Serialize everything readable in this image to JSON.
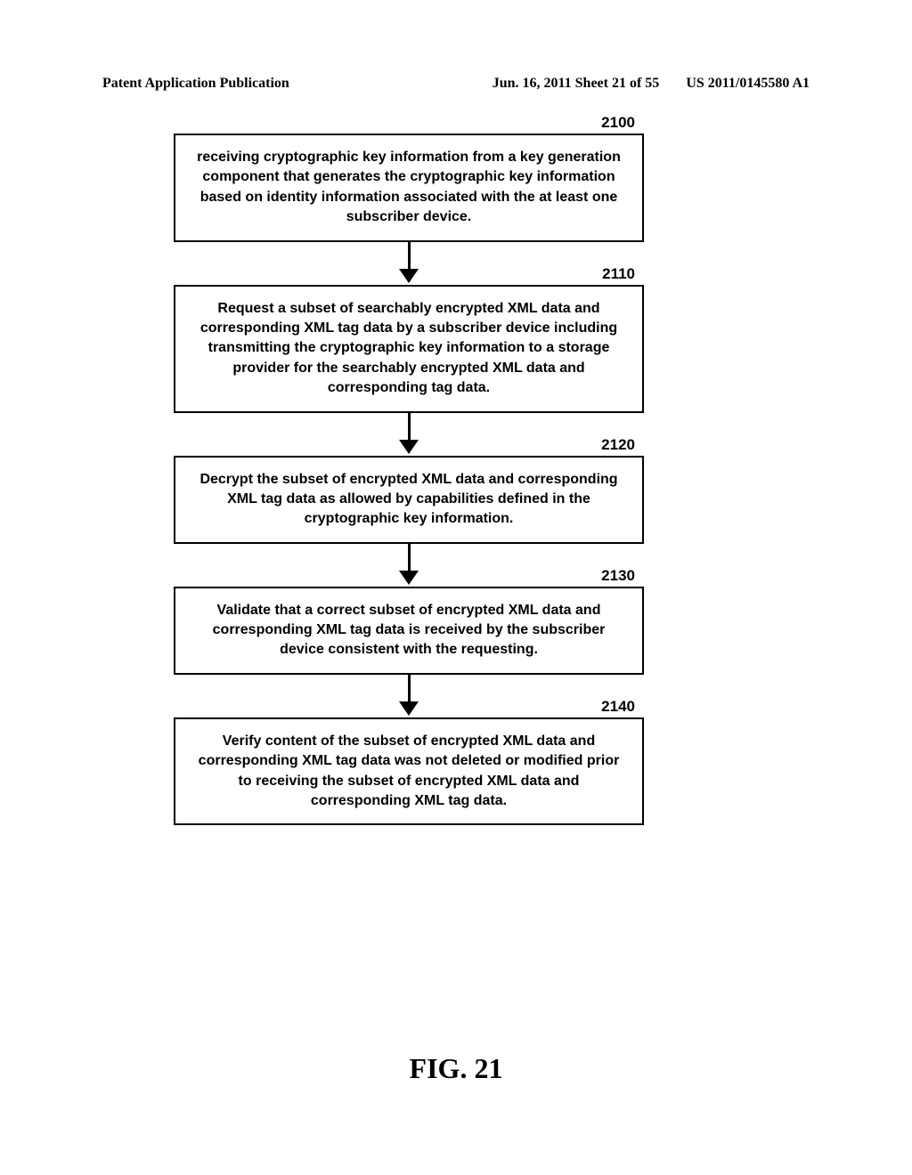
{
  "header": {
    "left": "Patent Application Publication",
    "center": "Jun. 16, 2011  Sheet 21 of 55",
    "right": "US 2011/0145580 A1"
  },
  "steps": [
    {
      "label": "2100",
      "text": "receiving cryptographic key information from a key generation component that generates the cryptographic key information based on identity information associated with the at least one subscriber device."
    },
    {
      "label": "2110",
      "text": "Request a subset of searchably encrypted XML data and corresponding XML tag data by a subscriber device including transmitting the cryptographic key information to a storage provider for the searchably encrypted XML data and corresponding tag data."
    },
    {
      "label": "2120",
      "text": "Decrypt the subset of encrypted XML data and corresponding XML tag data as allowed by capabilities defined in the cryptographic key information."
    },
    {
      "label": "2130",
      "text": "Validate that a correct subset of encrypted XML data and corresponding XML tag data is received by the subscriber device consistent with the requesting."
    },
    {
      "label": "2140",
      "text": "Verify content of the subset of encrypted XML data and corresponding XML tag data was not deleted or modified prior to receiving the subset of encrypted XML data and corresponding XML tag data."
    }
  ],
  "figure_label": "FIG. 21"
}
